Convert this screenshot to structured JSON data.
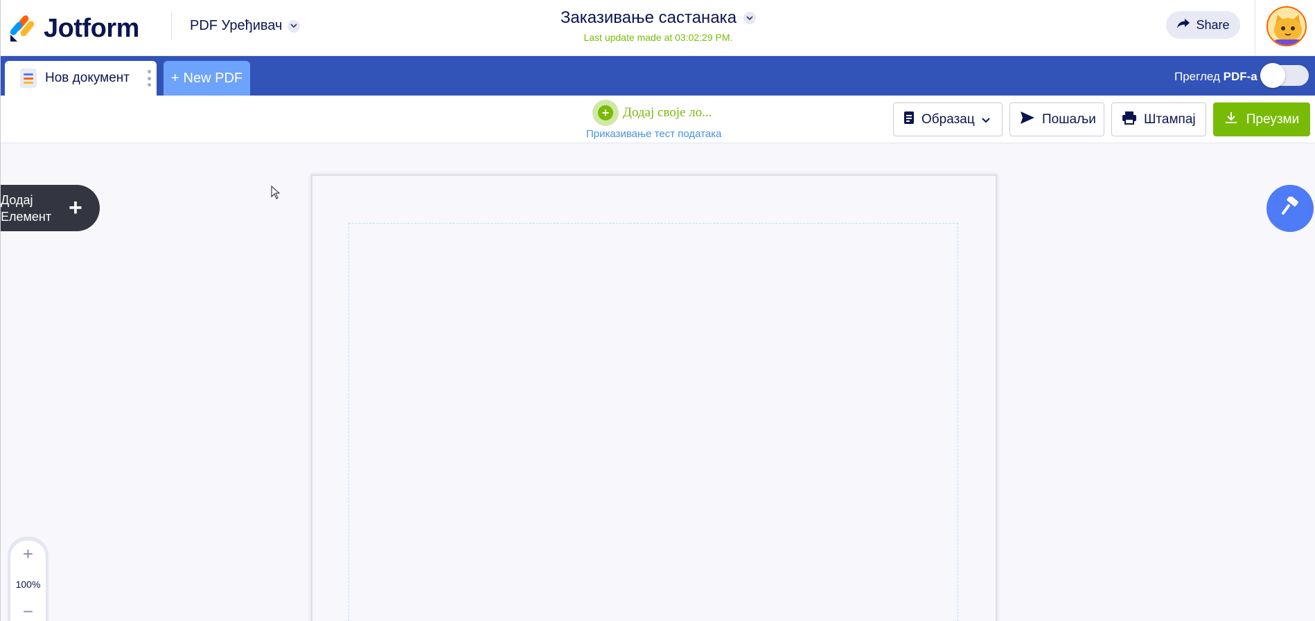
{
  "header": {
    "logo_text": "Jotform",
    "app_switch_label": "PDF Уређивач",
    "doc_title": "Заказивање састанака",
    "last_update": "Last update made at 03:02:29 PM.",
    "share_label": "Share"
  },
  "tabs": {
    "doc_tab_label": "Нов документ",
    "new_pdf_label": "New PDF",
    "preview_label": "Преглед",
    "preview_label_bold": "PDF-а"
  },
  "toolbar": {
    "add_logo_label": "Додај своје ло...",
    "test_data_label": "Приказивање тест података",
    "template_label": "Образац",
    "send_label": "Пошаљи",
    "print_label": "Штампај",
    "download_label": "Преузми"
  },
  "canvas": {
    "add_element_label": "Додај Елемент",
    "zoom_level": "100%"
  },
  "colors": {
    "brand_navy": "#0a1551",
    "tabbar_blue": "#3253b8",
    "new_pdf_blue": "#6ea3fb",
    "accent_green": "#78bb07",
    "paint_blue": "#4e7bf6"
  },
  "icons": {
    "logo": "jotform-logo-icon",
    "app_switch": "chevron-down-icon",
    "share": "share-arrow-icon",
    "doc": "document-icon",
    "more": "kebab-icon",
    "template": "form-icon",
    "send": "paper-plane-icon",
    "print": "printer-icon",
    "download": "download-icon",
    "paint": "paint-roller-icon"
  }
}
